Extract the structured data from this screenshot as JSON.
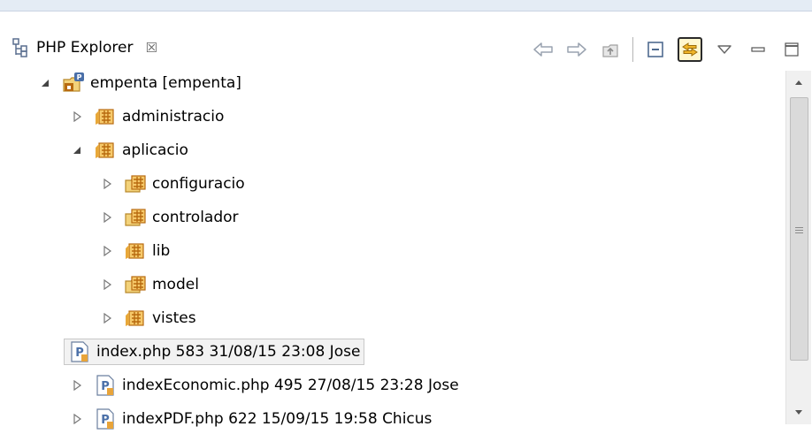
{
  "view": {
    "title": "PHP Explorer",
    "close_glyph": "☒"
  },
  "toolbar": {
    "buttons": [
      {
        "icon": "back-arrow-icon"
      },
      {
        "icon": "forward-arrow-icon"
      },
      {
        "icon": "up-folder-icon"
      },
      {
        "icon": "collapse-all-icon"
      },
      {
        "icon": "link-with-editor-icon",
        "selected": true
      },
      {
        "icon": "view-menu-icon"
      },
      {
        "icon": "minimize-icon"
      },
      {
        "icon": "maximize-icon"
      }
    ]
  },
  "tree": {
    "items": [
      {
        "label": "empenta [empenta]",
        "type": "project",
        "expanded": true
      },
      {
        "label": "administracio",
        "type": "package",
        "expanded": false
      },
      {
        "label": "aplicacio",
        "type": "package",
        "expanded": true
      },
      {
        "label": "configuracio",
        "type": "package-folder",
        "expanded": false
      },
      {
        "label": "controlador",
        "type": "package-folder",
        "expanded": false
      },
      {
        "label": "lib",
        "type": "package",
        "expanded": false
      },
      {
        "label": "model",
        "type": "package-folder",
        "expanded": false
      },
      {
        "label": "vistes",
        "type": "package",
        "expanded": false
      },
      {
        "label": "index.php 583  31/08/15 23:08  Jose",
        "type": "php-file",
        "expanded": false,
        "selected": true
      },
      {
        "label": "indexEconomic.php 495  27/08/15 23:28  Jose",
        "type": "php-file",
        "expanded": false
      },
      {
        "label": "indexPDF.php 622  15/09/15 19:58  Chicus",
        "type": "php-file",
        "expanded": false
      }
    ]
  },
  "colors": {
    "accent_selected": "#fff7cf",
    "package_brown": "#b86a10",
    "php_blue": "#4a6fa8"
  }
}
